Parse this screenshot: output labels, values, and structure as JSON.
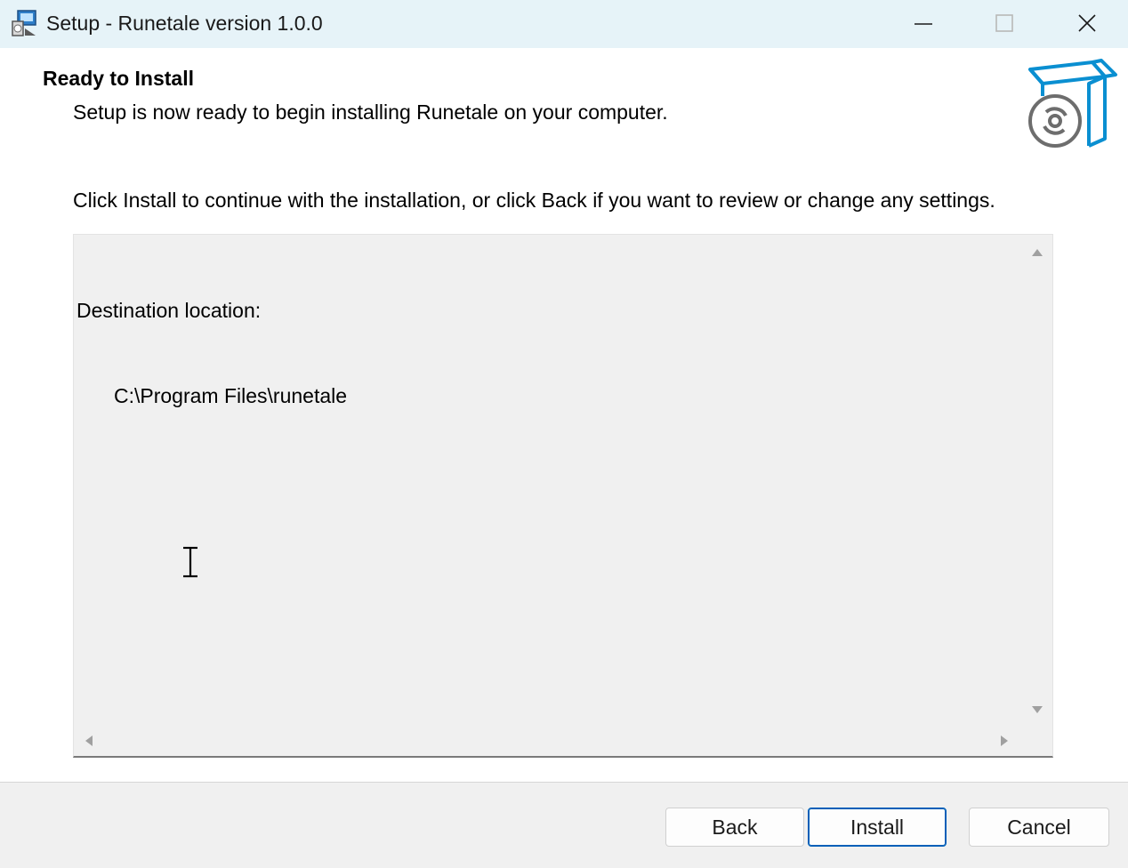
{
  "window": {
    "title": "Setup - Runetale version 1.0.0",
    "icon": "installer-icon",
    "controls": [
      "minimize-icon",
      "maximize-icon",
      "close-icon"
    ]
  },
  "header": {
    "title": "Ready to Install",
    "subtitle": "Setup is now ready to begin installing Runetale on your computer.",
    "image": "box-disc-icon"
  },
  "instructions": "Click Install to continue with the installation, or click Back if you want to review or change any settings.",
  "memo": {
    "label": "Destination location:",
    "value": "C:\\Program Files\\runetale"
  },
  "buttons": {
    "back": "Back",
    "install": "Install",
    "cancel": "Cancel"
  },
  "colors": {
    "titlebar": "#e6f3f8",
    "accent": "#0a8fd1",
    "default_button_border": "#005fb8"
  }
}
